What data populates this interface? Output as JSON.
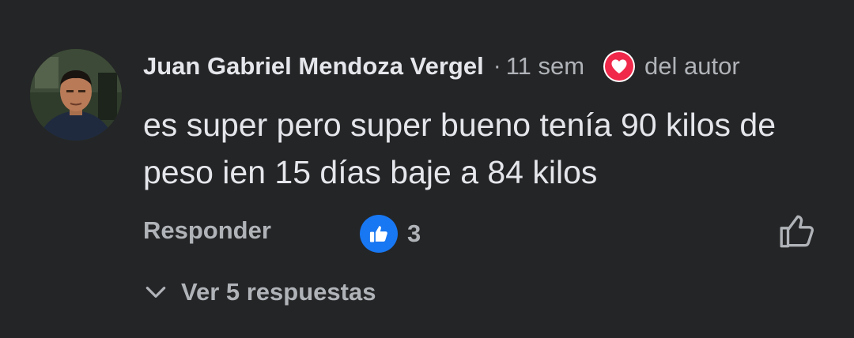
{
  "comment": {
    "author": "Juan Gabriel Mendoza Vergel",
    "separator": "·",
    "time": "11 sem",
    "author_badge": "del autor",
    "body": "es super pero super bueno tenía 90 kilos de peso ien 15 días baje a 84 kilos",
    "avatar_icon": "profile-photo",
    "heart_icon": "heart-icon"
  },
  "actions": {
    "reply_label": "Responder",
    "reaction_count": "3",
    "reaction_icon": "thumbs-up-icon",
    "like_icon": "thumbs-up-outline-icon"
  },
  "replies": {
    "label": "Ver 5 respuestas",
    "icon": "chevron-down-icon"
  },
  "colors": {
    "background": "#242526",
    "text_primary": "#e4e6eb",
    "text_secondary": "#b0b3b8",
    "like_blue": "#1877f2",
    "heart_red": "#f0284a"
  }
}
